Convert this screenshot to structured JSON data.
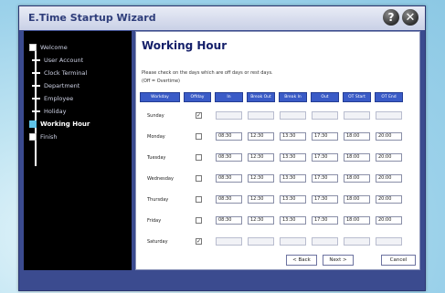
{
  "window": {
    "title": "E.Time Startup Wizard"
  },
  "sidebar": {
    "items": [
      {
        "label": "Welcome"
      },
      {
        "label": "User Account"
      },
      {
        "label": "Clock Terminal"
      },
      {
        "label": "Department"
      },
      {
        "label": "Employee"
      },
      {
        "label": "Holiday"
      },
      {
        "label": "Working Hour",
        "active": true
      },
      {
        "label": "Finish"
      }
    ]
  },
  "main": {
    "heading": "Working Hour",
    "instruction": "Please check on the days which are off days or rest days.",
    "note": "(Off = Overtime)",
    "columns": [
      "Workday",
      "Offday",
      "In",
      "Break Out",
      "Break In",
      "Out",
      "OT Start",
      "OT End"
    ],
    "rows": [
      {
        "day": "Sunday",
        "offday": true,
        "times": [
          "",
          "",
          "",
          "",
          "",
          ""
        ]
      },
      {
        "day": "Monday",
        "offday": false,
        "times": [
          "08:30",
          "12:30",
          "13:30",
          "17:30",
          "18:00",
          "20:00"
        ]
      },
      {
        "day": "Tuesday",
        "offday": false,
        "times": [
          "08:30",
          "12:30",
          "13:30",
          "17:30",
          "18:00",
          "20:00"
        ]
      },
      {
        "day": "Wednesday",
        "offday": false,
        "times": [
          "08:30",
          "12:30",
          "13:30",
          "17:30",
          "18:00",
          "20:00"
        ]
      },
      {
        "day": "Thursday",
        "offday": false,
        "times": [
          "08:30",
          "12:30",
          "13:30",
          "17:30",
          "18:00",
          "20:00"
        ]
      },
      {
        "day": "Friday",
        "offday": false,
        "times": [
          "08:30",
          "12:30",
          "13:30",
          "17:30",
          "18:00",
          "20:00"
        ]
      },
      {
        "day": "Saturday",
        "offday": true,
        "times": [
          "",
          "",
          "",
          "",
          "",
          ""
        ]
      }
    ]
  },
  "footer": {
    "back": "< Back",
    "next": "Next >",
    "cancel": "Cancel"
  },
  "colors": {
    "frame": "#3b4b8f",
    "header": "#3a5bc7",
    "sidebar": "#000000",
    "active": "#5fc3e8"
  }
}
